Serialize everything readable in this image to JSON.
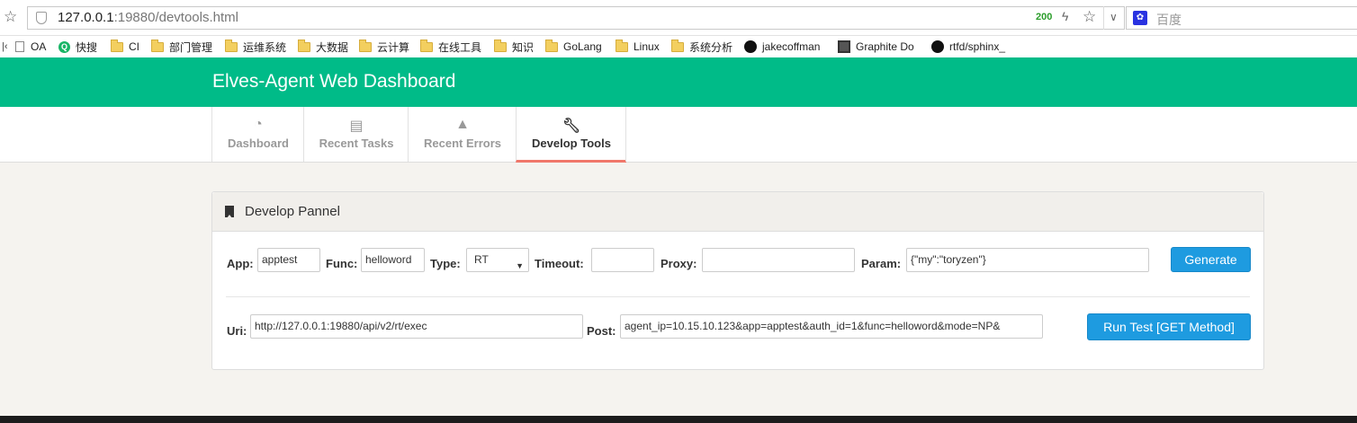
{
  "browser": {
    "url_host": "127.0.0.1",
    "url_rest": ":19880/devtools.html",
    "status_code": "200",
    "search_placeholder": "百度",
    "search_engine_icon": "baidu-icon"
  },
  "bookmarks": [
    {
      "label": "OA",
      "icon": "page-icon"
    },
    {
      "label": "快搜",
      "icon": "q-icon"
    },
    {
      "label": "CI",
      "icon": "folder-icon"
    },
    {
      "label": "部门管理",
      "icon": "folder-icon"
    },
    {
      "label": "运维系统",
      "icon": "folder-icon"
    },
    {
      "label": "大数据",
      "icon": "folder-icon"
    },
    {
      "label": "云计算",
      "icon": "folder-icon"
    },
    {
      "label": "在线工具",
      "icon": "folder-icon"
    },
    {
      "label": "知识",
      "icon": "folder-icon"
    },
    {
      "label": "GoLang",
      "icon": "folder-icon"
    },
    {
      "label": "Linux",
      "icon": "folder-icon"
    },
    {
      "label": "系统分析",
      "icon": "folder-icon"
    },
    {
      "label": "jakecoffman",
      "icon": "github-icon"
    },
    {
      "label": "Graphite Do",
      "icon": "graphite-icon"
    },
    {
      "label": "rtfd/sphinx_",
      "icon": "github-icon"
    }
  ],
  "header": {
    "title": "Elves-Agent Web Dashboard",
    "color": "#00bb88"
  },
  "nav": {
    "tabs": [
      {
        "label": "Dashboard",
        "icon": "dashboard-icon"
      },
      {
        "label": "Recent Tasks",
        "icon": "list-icon"
      },
      {
        "label": "Recent Errors",
        "icon": "warning-icon"
      },
      {
        "label": "Develop Tools",
        "icon": "wrench-icon",
        "active": true
      }
    ],
    "active_color": "#f0776a"
  },
  "panel": {
    "title": "Develop Pannel",
    "app_label": "App:",
    "app_value": "apptest",
    "func_label": "Func:",
    "func_value": "helloword",
    "type_label": "Type:",
    "type_value": "RT",
    "timeout_label": "Timeout:",
    "timeout_value": "",
    "proxy_label": "Proxy:",
    "proxy_value": "",
    "param_label": "Param:",
    "param_value": "{\"my\":\"toryzen\"}",
    "generate_label": "Generate",
    "uri_label": "Uri:",
    "uri_value": "http://127.0.0.1:19880/api/v2/rt/exec",
    "post_label": "Post:",
    "post_value": "agent_ip=10.15.10.123&app=apptest&auth_id=1&func=helloword&mode=NP&",
    "run_label": "Run Test [GET Method]",
    "button_color": "#1e9be0"
  }
}
